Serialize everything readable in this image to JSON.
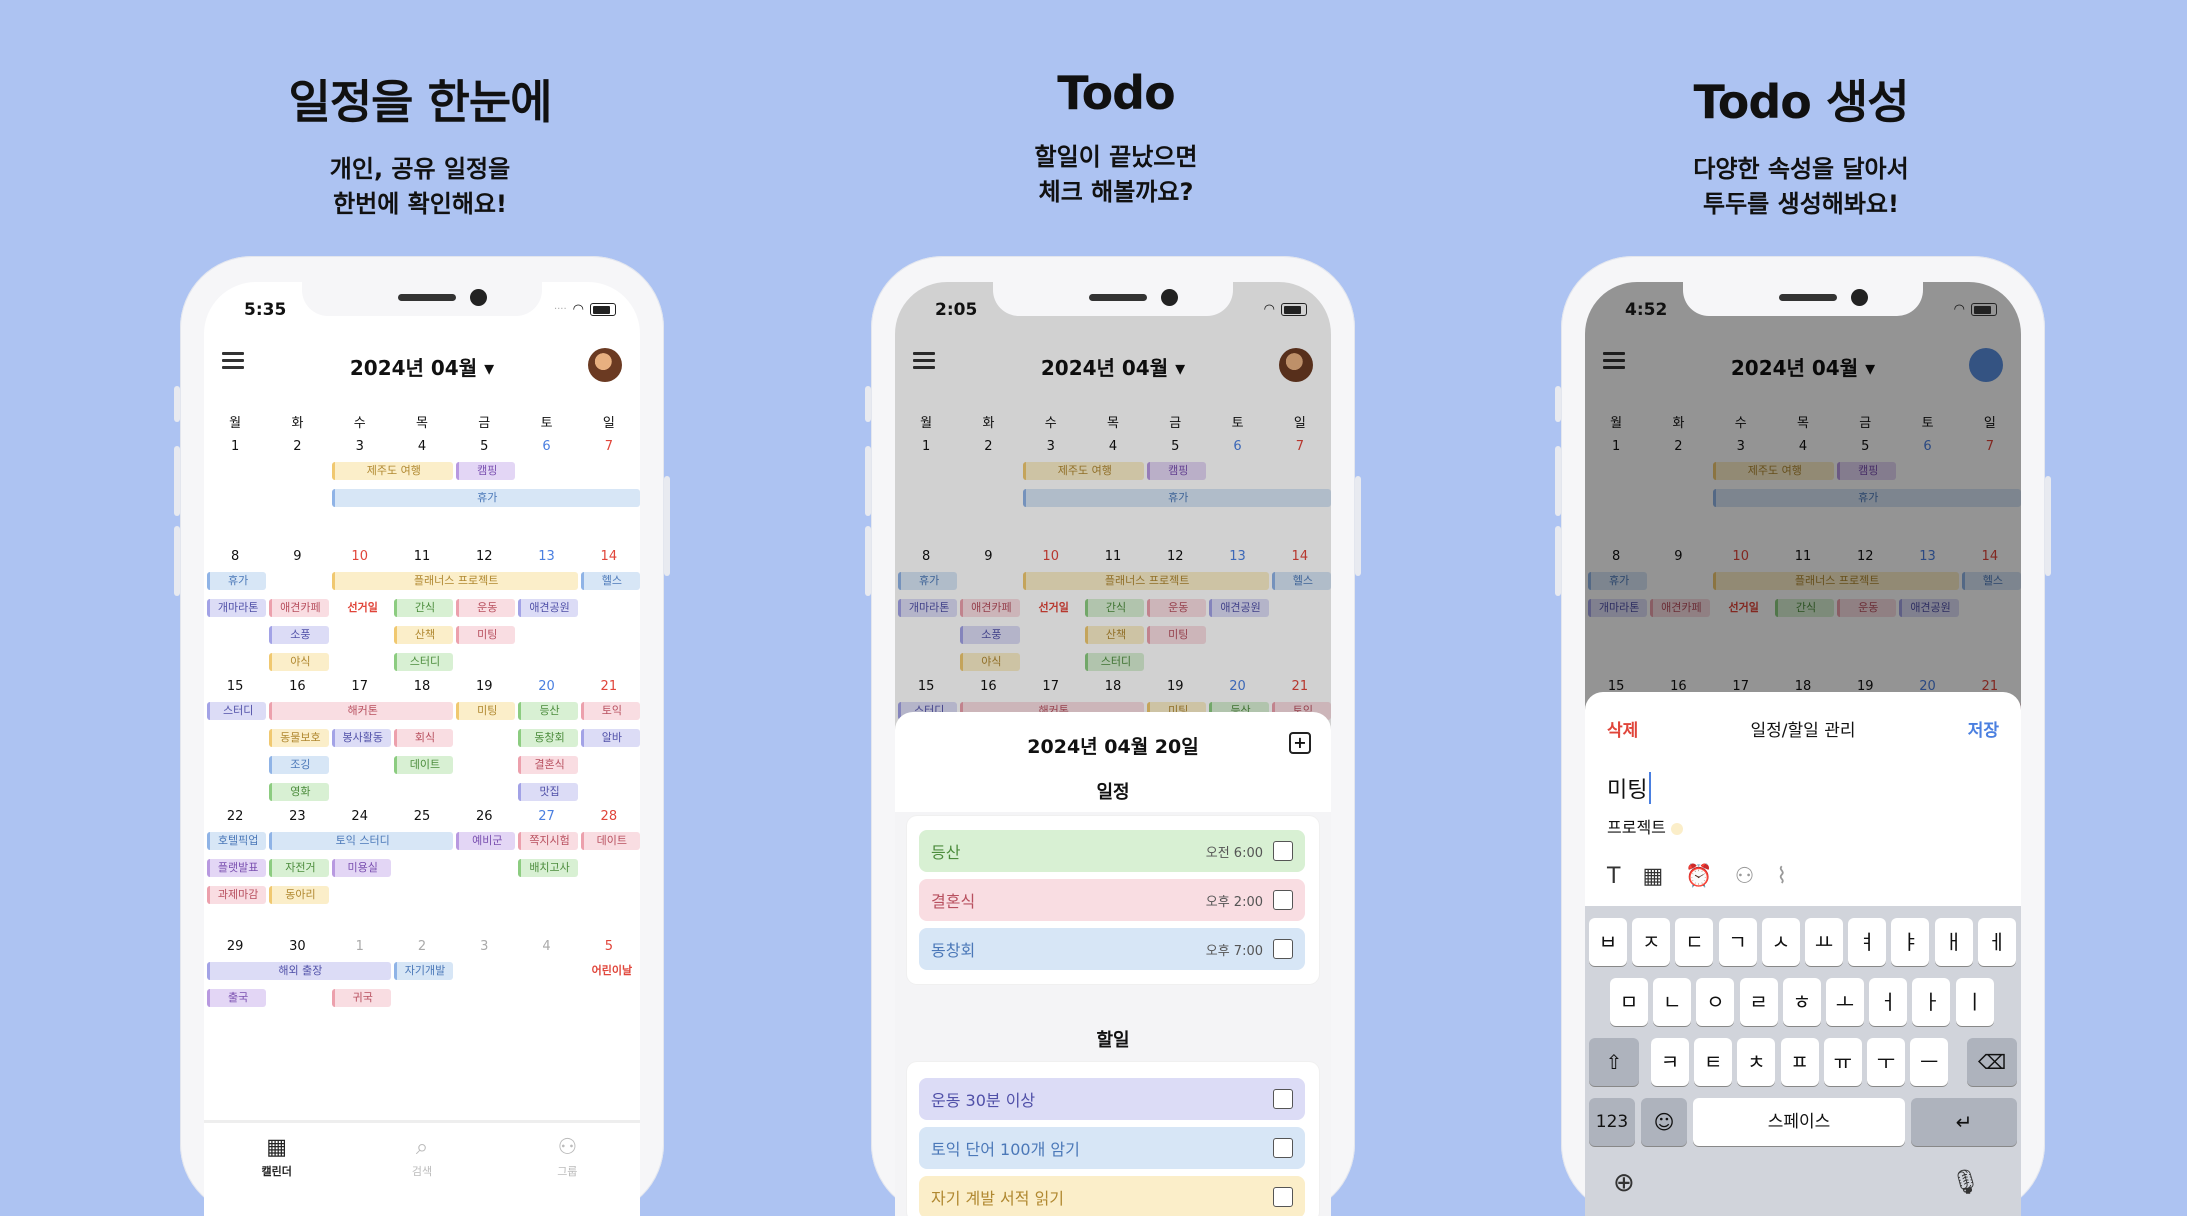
{
  "promos": [
    {
      "title": "일정을 한눈에",
      "line1": "개인, 공유 일정을",
      "line2": "한번에 확인해요!"
    },
    {
      "title": "Todo",
      "line1": "할일이 끝났으면",
      "line2": "체크 해볼까요?"
    },
    {
      "title": "Todo 생성",
      "line1": "다양한 속성을 달아서",
      "line2": "투두를 생성해봐요!"
    }
  ],
  "phones": [
    {
      "time": "5:35"
    },
    {
      "time": "2:05"
    },
    {
      "time": "4:52"
    }
  ],
  "header": {
    "month": "2024년 04월 ▾"
  },
  "weekdays": [
    "월",
    "화",
    "수",
    "목",
    "금",
    "토",
    "일"
  ],
  "weeks": [
    [
      "1",
      "2",
      "3",
      "4",
      "5",
      "6",
      "7"
    ],
    [
      "8",
      "9",
      "10",
      "11",
      "12",
      "13",
      "14"
    ],
    [
      "15",
      "16",
      "17",
      "18",
      "19",
      "20",
      "21"
    ],
    [
      "22",
      "23",
      "24",
      "25",
      "26",
      "27",
      "28"
    ],
    [
      "29",
      "30",
      "1",
      "2",
      "3",
      "4",
      "5"
    ]
  ],
  "events": {
    "w1": [
      "제주도 여행",
      "캠핑",
      "휴가"
    ],
    "w2": [
      "휴가",
      "플래너스 프로젝트",
      "헬스",
      "개마라톤",
      "애견카페",
      "선거일",
      "간식",
      "운동",
      "애견공원",
      "소풍",
      "산책",
      "미팅",
      "야식",
      "스터디"
    ],
    "w3": [
      "스터디",
      "해커톤",
      "미팅",
      "등산",
      "토익",
      "동물보호",
      "봉사활동",
      "회식",
      "동창회",
      "알바",
      "조깅",
      "데이트",
      "결혼식",
      "영화",
      "맛집"
    ],
    "w4": [
      "호텔픽업",
      "토익 스터디",
      "예비군",
      "쪽지시험",
      "데이트",
      "플랫발표",
      "자전거",
      "미용실",
      "배치고사",
      "과제마감",
      "동아리"
    ],
    "w5": [
      "해외 출장",
      "자기개발",
      "어린이날",
      "출국",
      "귀국"
    ]
  },
  "tabs": [
    "캘린더",
    "검색",
    "그룹"
  ],
  "todo": {
    "sheet_title": "2024년 04월 20일",
    "schedule_label": "일정",
    "schedules": [
      {
        "name": "등산",
        "time": "오전 6:00"
      },
      {
        "name": "결혼식",
        "time": "오후 2:00"
      },
      {
        "name": "동창회",
        "time": "오후 7:00"
      }
    ],
    "todo_label": "할일",
    "todos": [
      "운동 30분 이상",
      "토익 단어 100개 암기",
      "자기 계발 서적 읽기"
    ]
  },
  "create": {
    "delete": "삭제",
    "title": "일정/할일 관리",
    "save": "저장",
    "input_value": "미팅",
    "project_label": "프로젝트",
    "toolbar_icons": [
      "text-icon",
      "calendar-icon",
      "alarm-icon",
      "people-icon",
      "paperclip-icon"
    ],
    "keys_row1": [
      "ㅂ",
      "ㅈ",
      "ㄷ",
      "ㄱ",
      "ㅅ",
      "ㅛ",
      "ㅕ",
      "ㅑ",
      "ㅐ",
      "ㅔ"
    ],
    "keys_row2": [
      "ㅁ",
      "ㄴ",
      "ㅇ",
      "ㄹ",
      "ㅎ",
      "ㅗ",
      "ㅓ",
      "ㅏ",
      "ㅣ"
    ],
    "keys_row3": [
      "ㅋ",
      "ㅌ",
      "ㅊ",
      "ㅍ",
      "ㅠ",
      "ㅜ",
      "ㅡ"
    ],
    "num_key": "123",
    "space_key": "스페이스"
  },
  "colors": {
    "background": "#adc3f2",
    "accent_red": "#e0453a",
    "accent_blue": "#4a7fe0"
  }
}
